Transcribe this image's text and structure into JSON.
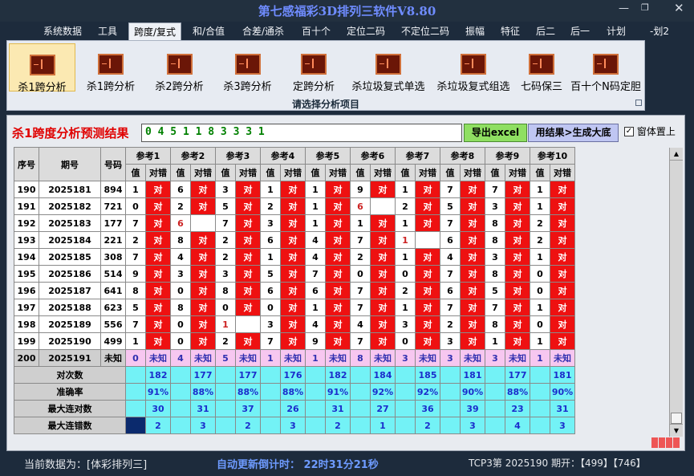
{
  "window": {
    "title": "第七感福彩3D排列三软件V8.80",
    "min_icon": "minimize-icon",
    "max_icon": "maximize-icon",
    "close_icon": "close-icon"
  },
  "menu": [
    "系统数据",
    "工具",
    "跨度/复式",
    "和/合值",
    "合差/通杀",
    "百十个",
    "定位二码",
    "不定位二码",
    "振幅",
    "特征",
    "后二",
    "后一",
    "计划",
    "-划2"
  ],
  "ribbon": {
    "buttons": [
      "杀1跨分析",
      "杀1跨分析",
      "杀2跨分析",
      "杀3跨分析",
      "定跨分析",
      "杀垃圾复式单选",
      "杀垃圾复式组选",
      "七码保三",
      "百十个N码定胆"
    ],
    "caption": "请选择分析项目"
  },
  "result": {
    "label": "杀1跨度分析预测结果",
    "value": "0 4 5 1 1 8 3 3 3 1",
    "export_label": "导出excel",
    "generate_label": "用结果>生成大底",
    "topmost_label": "窗体置上",
    "topmost_checked": true
  },
  "table": {
    "head": {
      "no": "序号",
      "period": "期号",
      "code": "号码",
      "val": "值",
      "hit": "对错"
    },
    "refs": [
      "参考1",
      "参考2",
      "参考3",
      "参考4",
      "参考5",
      "参考6",
      "参考7",
      "参考8",
      "参考9",
      "参考10"
    ],
    "hit_text": "对",
    "rows": [
      {
        "no": "190",
        "period": "2025181",
        "code": "894",
        "vals": [
          "1",
          "6",
          "3",
          "1",
          "1",
          "9",
          "1",
          "7",
          "7",
          "1"
        ],
        "hits": [
          1,
          1,
          1,
          1,
          1,
          1,
          1,
          1,
          1,
          1
        ]
      },
      {
        "no": "191",
        "period": "2025182",
        "code": "721",
        "vals": [
          "0",
          "2",
          "5",
          "2",
          "1",
          "6",
          "2",
          "5",
          "3",
          "1"
        ],
        "hits": [
          1,
          1,
          1,
          1,
          1,
          0,
          1,
          1,
          1,
          1
        ]
      },
      {
        "no": "192",
        "period": "2025183",
        "code": "177",
        "vals": [
          "7",
          "6",
          "7",
          "3",
          "1",
          "1",
          "1",
          "7",
          "8",
          "2"
        ],
        "hits": [
          1,
          0,
          1,
          1,
          1,
          1,
          1,
          1,
          1,
          1
        ]
      },
      {
        "no": "193",
        "period": "2025184",
        "code": "221",
        "vals": [
          "2",
          "8",
          "2",
          "6",
          "4",
          "7",
          "1",
          "6",
          "8",
          "2"
        ],
        "hits": [
          1,
          1,
          1,
          1,
          1,
          1,
          0,
          1,
          1,
          1
        ]
      },
      {
        "no": "194",
        "period": "2025185",
        "code": "308",
        "vals": [
          "7",
          "4",
          "2",
          "1",
          "4",
          "2",
          "1",
          "4",
          "3",
          "1"
        ],
        "hits": [
          1,
          1,
          1,
          1,
          1,
          1,
          1,
          1,
          1,
          1
        ]
      },
      {
        "no": "195",
        "period": "2025186",
        "code": "514",
        "vals": [
          "9",
          "3",
          "3",
          "5",
          "7",
          "0",
          "0",
          "7",
          "8",
          "0"
        ],
        "hits": [
          1,
          1,
          1,
          1,
          1,
          1,
          1,
          1,
          1,
          1
        ]
      },
      {
        "no": "196",
        "period": "2025187",
        "code": "641",
        "vals": [
          "8",
          "0",
          "8",
          "6",
          "6",
          "7",
          "2",
          "6",
          "5",
          "0"
        ],
        "hits": [
          1,
          1,
          1,
          1,
          1,
          1,
          1,
          1,
          1,
          1
        ]
      },
      {
        "no": "197",
        "period": "2025188",
        "code": "623",
        "vals": [
          "5",
          "8",
          "0",
          "0",
          "1",
          "7",
          "1",
          "7",
          "7",
          "1"
        ],
        "hits": [
          1,
          1,
          1,
          1,
          1,
          1,
          1,
          1,
          1,
          1
        ]
      },
      {
        "no": "198",
        "period": "2025189",
        "code": "556",
        "vals": [
          "7",
          "0",
          "1",
          "3",
          "4",
          "4",
          "3",
          "2",
          "8",
          "0"
        ],
        "hits": [
          1,
          1,
          0,
          1,
          1,
          1,
          1,
          1,
          1,
          1
        ]
      },
      {
        "no": "199",
        "period": "2025190",
        "code": "499",
        "vals": [
          "1",
          "0",
          "2",
          "7",
          "9",
          "7",
          "0",
          "3",
          "1",
          "1"
        ],
        "hits": [
          1,
          1,
          1,
          1,
          1,
          1,
          1,
          1,
          1,
          1
        ]
      }
    ],
    "predict": {
      "no": "200",
      "period": "2025191",
      "code": "未知",
      "vals": [
        "0",
        "4",
        "5",
        "1",
        "1",
        "8",
        "3",
        "3",
        "3",
        "1"
      ],
      "hit_text": "未知"
    },
    "stats": [
      {
        "label": "对次数",
        "vals": [
          "182",
          "177",
          "177",
          "176",
          "182",
          "184",
          "185",
          "181",
          "177",
          "181"
        ]
      },
      {
        "label": "准确率",
        "vals": [
          "91%",
          "88%",
          "88%",
          "88%",
          "91%",
          "92%",
          "92%",
          "90%",
          "88%",
          "90%"
        ]
      },
      {
        "label": "最大连对数",
        "vals": [
          "30",
          "31",
          "37",
          "26",
          "31",
          "27",
          "36",
          "39",
          "23",
          "31"
        ]
      },
      {
        "label": "最大连错数",
        "vals": [
          "2",
          "3",
          "2",
          "3",
          "2",
          "1",
          "2",
          "3",
          "4",
          "3"
        ]
      }
    ]
  },
  "status": {
    "current": "当前数据为：[体彩排列三]",
    "countdown": "自动更新倒计时：  22时31分21秒",
    "tcp": "TCP3第 2025190 期开：【499】【746】"
  },
  "colors": {
    "hit": "#ee1111",
    "stat": "#73f2f6",
    "unknown": "#f7c7f0",
    "title": "#6f8cff",
    "result": "#e00000"
  }
}
